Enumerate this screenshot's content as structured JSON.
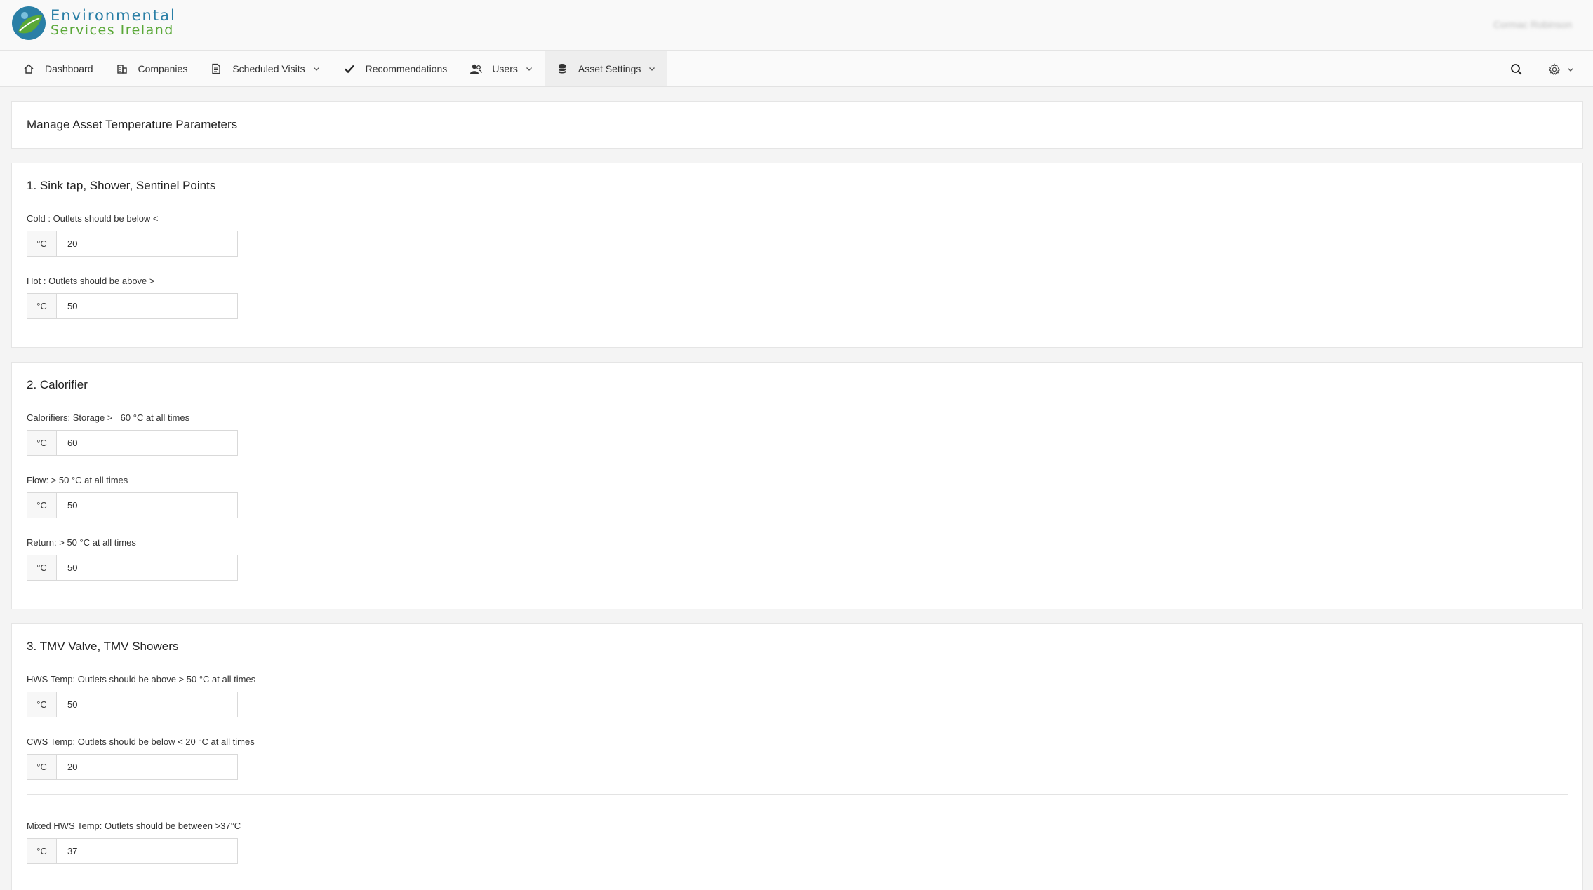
{
  "header": {
    "logo_line1": "Environmental",
    "logo_line2": "Services Ireland",
    "user_name": "Cormac Robinson"
  },
  "nav": {
    "items": [
      {
        "label": "Dashboard",
        "icon": "home-icon"
      },
      {
        "label": "Companies",
        "icon": "building-icon"
      },
      {
        "label": "Scheduled Visits",
        "icon": "document-icon",
        "dropdown": true
      },
      {
        "label": "Recommendations",
        "icon": "check-icon"
      },
      {
        "label": "Users",
        "icon": "users-icon",
        "dropdown": true
      },
      {
        "label": "Asset Settings",
        "icon": "database-icon",
        "dropdown": true,
        "active": true
      }
    ]
  },
  "page": {
    "title": "Manage Asset Temperature Parameters"
  },
  "sections": [
    {
      "title": "1. Sink tap, Shower, Sentinel Points",
      "fields": [
        {
          "label": "Cold : Outlets should be below <",
          "unit": "°C",
          "value": "20"
        },
        {
          "label": "Hot : Outlets should be above >",
          "unit": "°C",
          "value": "50"
        }
      ]
    },
    {
      "title": "2. Calorifier",
      "fields": [
        {
          "label": "Calorifiers: Storage >= 60 °C at all times",
          "unit": "°C",
          "value": "60"
        },
        {
          "label": "Flow: > 50 °C at all times",
          "unit": "°C",
          "value": "50"
        },
        {
          "label": "Return: > 50 °C at all times",
          "unit": "°C",
          "value": "50"
        }
      ]
    },
    {
      "title": "3. TMV Valve, TMV Showers",
      "fields": [
        {
          "label": "HWS Temp: Outlets should be above > 50 °C at all times",
          "unit": "°C",
          "value": "50"
        },
        {
          "label": "CWS Temp: Outlets should be below < 20 °C at all times",
          "unit": "°C",
          "value": "20"
        },
        {
          "label": "Mixed HWS Temp: Outlets should be between >37°C",
          "unit": "°C",
          "value": "37"
        }
      ]
    }
  ],
  "colors": {
    "logo_blue": "#2a7fa6",
    "logo_green": "#5aa838",
    "active_nav": "#eeeeee"
  }
}
